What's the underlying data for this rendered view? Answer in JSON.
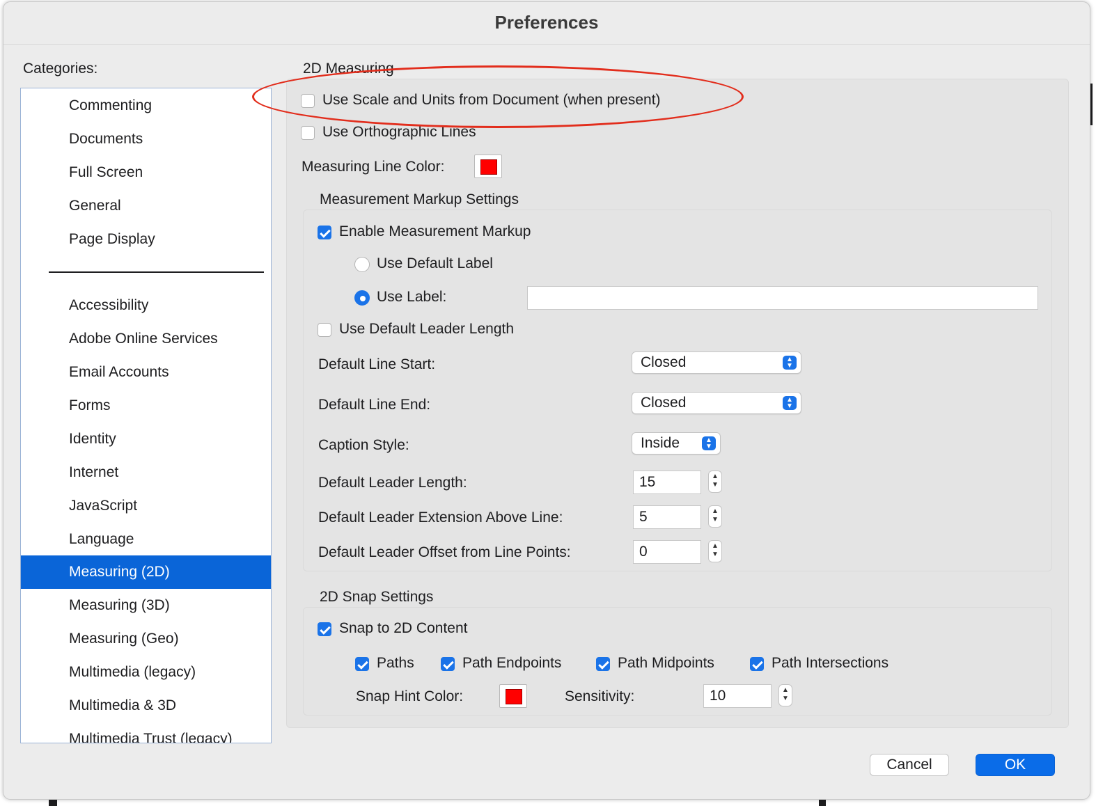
{
  "dialog": {
    "title": "Preferences"
  },
  "categories": {
    "heading": "Categories:",
    "items": [
      "Commenting",
      "Documents",
      "Full Screen",
      "General",
      "Page Display",
      "Accessibility",
      "Adobe Online Services",
      "Email Accounts",
      "Forms",
      "Identity",
      "Internet",
      "JavaScript",
      "Language",
      "Measuring (2D)",
      "Measuring (3D)",
      "Measuring (Geo)",
      "Multimedia (legacy)",
      "Multimedia & 3D",
      "Multimedia Trust (legacy)"
    ],
    "selected": "Measuring (2D)"
  },
  "measuring": {
    "section_title": "2D Measuring",
    "use_scale": {
      "label": "Use Scale and Units from Document (when present)",
      "checked": false
    },
    "use_ortho": {
      "label": "Use Orthographic Lines",
      "checked": false
    },
    "line_color_label": "Measuring Line Color:",
    "line_color": "#ff0000"
  },
  "markup": {
    "title": "Measurement Markup Settings",
    "enable": {
      "label": "Enable Measurement Markup",
      "checked": true
    },
    "use_default_label": {
      "label": "Use Default Label",
      "selected": false
    },
    "use_label": {
      "label": "Use Label:",
      "selected": true,
      "value": ""
    },
    "use_default_leader": {
      "label": "Use Default Leader Length",
      "checked": false
    },
    "line_start": {
      "label": "Default Line Start:",
      "value": "Closed"
    },
    "line_end": {
      "label": "Default Line End:",
      "value": "Closed"
    },
    "caption_style": {
      "label": "Caption Style:",
      "value": "Inside"
    },
    "leader_length": {
      "label": "Default Leader Length:",
      "value": "15"
    },
    "leader_extension": {
      "label": "Default Leader Extension Above Line:",
      "value": "5"
    },
    "leader_offset": {
      "label": "Default Leader Offset from Line Points:",
      "value": "0"
    }
  },
  "snap": {
    "title": "2D Snap Settings",
    "snap_content": {
      "label": "Snap to 2D Content",
      "checked": true
    },
    "paths": {
      "label": "Paths",
      "checked": true
    },
    "endpoints": {
      "label": "Path Endpoints",
      "checked": true
    },
    "midpoints": {
      "label": "Path Midpoints",
      "checked": true
    },
    "intersections": {
      "label": "Path Intersections",
      "checked": true
    },
    "hint_color_label": "Snap Hint Color:",
    "hint_color": "#ff0000",
    "sensitivity_label": "Sensitivity:",
    "sensitivity": "10"
  },
  "buttons": {
    "cancel": "Cancel",
    "ok": "OK"
  },
  "colors": {
    "accent": "#1a73e8",
    "selection": "#0a65d8",
    "annotation": "#e22d1c"
  }
}
